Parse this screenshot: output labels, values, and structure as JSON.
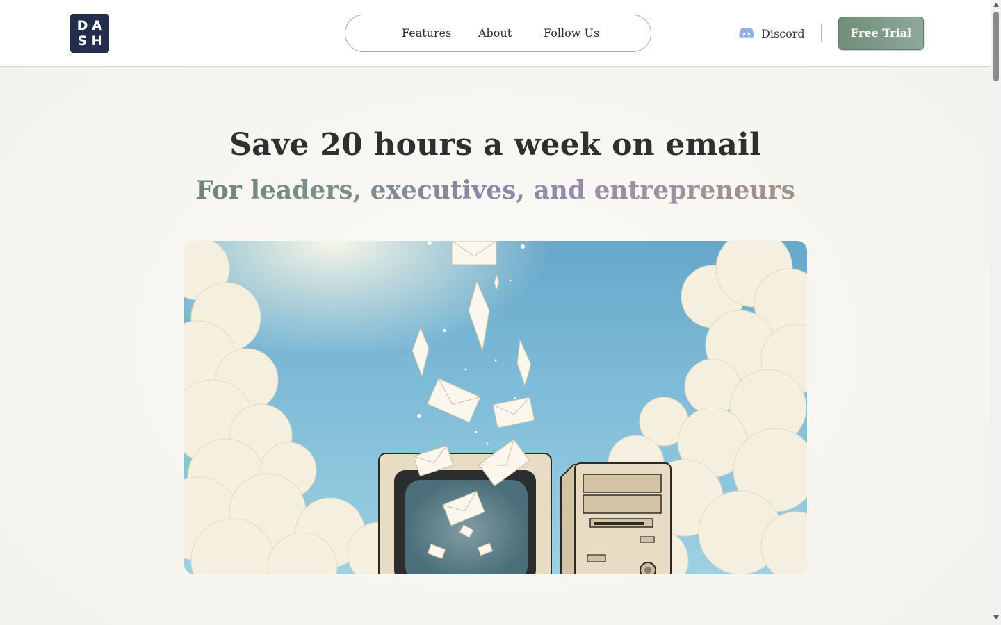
{
  "header": {
    "logo": {
      "letters": [
        "D",
        "A",
        "S",
        "H"
      ],
      "icon": "dash-logo"
    },
    "nav": [
      {
        "label": "Features"
      },
      {
        "label": "About"
      },
      {
        "label": "Follow Us"
      }
    ],
    "discord": {
      "label": "Discord",
      "icon": "discord-icon"
    },
    "cta": {
      "label": "Free Trial"
    }
  },
  "hero": {
    "title": "Save 20 hours a week on email",
    "subtitle": "For leaders, executives, and entrepreneurs",
    "image": {
      "icon": "retro-computer-envelopes-illustration"
    }
  },
  "colors": {
    "background": "#f7f6f2",
    "logo": "#232e4d",
    "cta": "#7a9683",
    "discord": "#8fb0e6",
    "nav_border": "#a9ae9e"
  }
}
